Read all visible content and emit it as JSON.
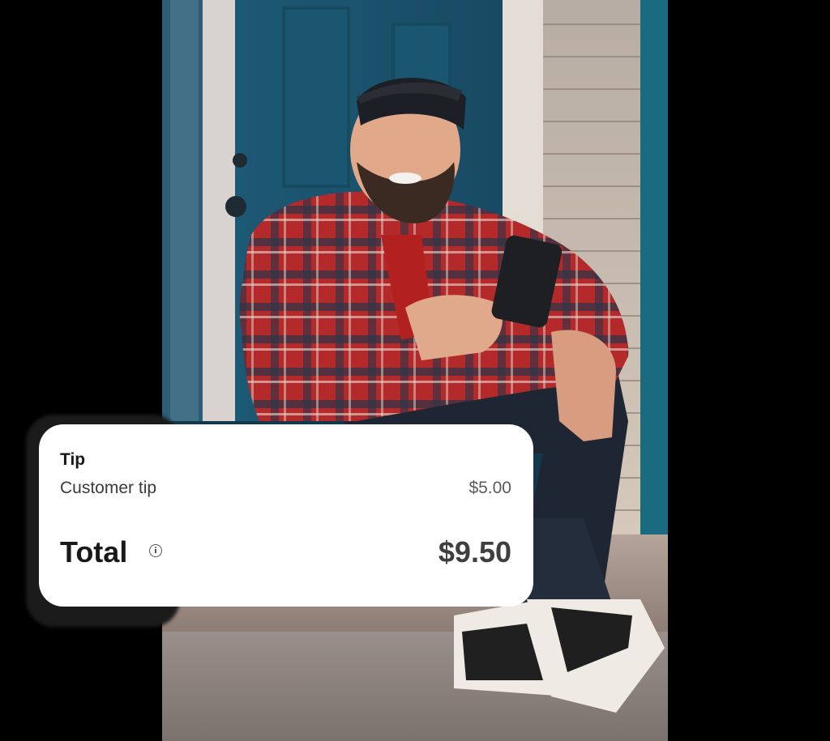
{
  "tip_card": {
    "section_title": "Tip",
    "line_item_label": "Customer tip",
    "line_item_value": "$5.00",
    "total_label": "Total",
    "total_value": "$9.50",
    "info_icon": "info-icon"
  },
  "colors": {
    "card_background": "#ffffff",
    "page_background": "#000000",
    "text_primary": "#191919",
    "text_secondary": "#5a5a5a"
  }
}
